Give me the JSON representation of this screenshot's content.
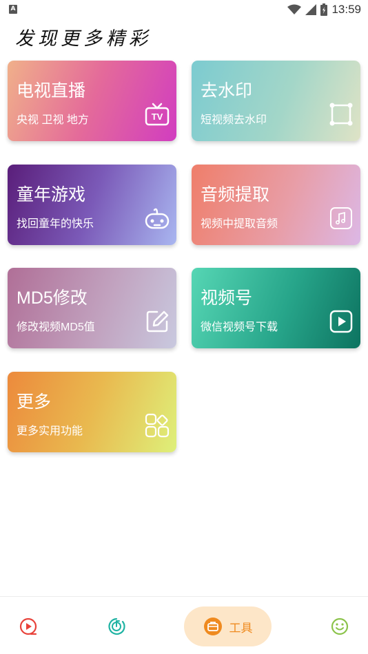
{
  "status_bar": {
    "time": "13:59",
    "notification_letter": "A"
  },
  "page": {
    "title": "发现更多精彩"
  },
  "cards": [
    {
      "title": "电视直播",
      "subtitle": "央视 卫视 地方",
      "icon": "tv-icon",
      "icon_text": "TV"
    },
    {
      "title": "去水印",
      "subtitle": "短视频去水印",
      "icon": "crop-frame-icon"
    },
    {
      "title": "童年游戏",
      "subtitle": "找回童年的快乐",
      "icon": "gamepad-icon"
    },
    {
      "title": "音频提取",
      "subtitle": "视频中提取音频",
      "icon": "music-note-icon"
    },
    {
      "title": "MD5修改",
      "subtitle": "修改视频MD5值",
      "icon": "edit-icon"
    },
    {
      "title": "视频号",
      "subtitle": "微信视频号下载",
      "icon": "play-icon"
    },
    {
      "title": "更多",
      "subtitle": "更多实用功能",
      "icon": "apps-grid-icon"
    }
  ],
  "bottom_nav": {
    "items": [
      {
        "icon": "video-play-icon",
        "color": "#e8423a"
      },
      {
        "icon": "music-disc-icon",
        "color": "#1fb3a3"
      },
      {
        "icon": "toolbox-icon",
        "label": "工具",
        "active": true,
        "color": "#ef8a1f"
      },
      {
        "icon": "smiley-icon",
        "color": "#8bc34a"
      }
    ]
  }
}
